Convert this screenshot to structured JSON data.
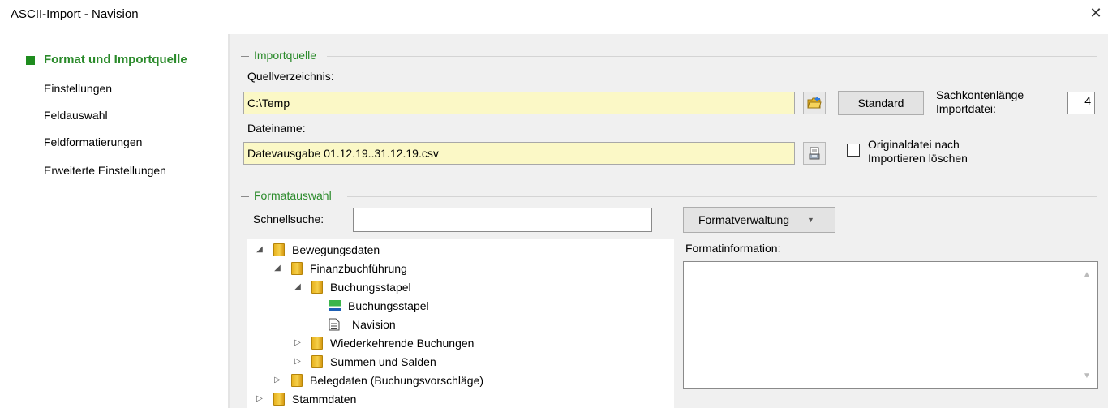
{
  "window": {
    "title": "ASCII-Import - Navision",
    "close_glyph": "✕"
  },
  "sidebar": {
    "items": [
      {
        "label": "Format und Importquelle",
        "active": true
      },
      {
        "label": "Einstellungen",
        "active": false
      },
      {
        "label": "Feldauswahl",
        "active": false
      },
      {
        "label": "Feldformatierungen",
        "active": false
      },
      {
        "label": "Erweiterte Einstellungen",
        "active": false
      }
    ]
  },
  "importquelle": {
    "group_title": "Importquelle",
    "source_dir_label": "Quellverzeichnis:",
    "source_dir_value": "C:\\Temp",
    "standard_button": "Standard",
    "account_length_label_1": "Sachkontenlänge",
    "account_length_label_2": "Importdatei:",
    "account_length_value": "4",
    "filename_label": "Dateiname:",
    "filename_value": "Datevausgabe 01.12.19..31.12.19.csv",
    "delete_checkbox_label_1": "Originaldatei nach",
    "delete_checkbox_label_2": "Importieren löschen",
    "delete_checkbox_checked": false
  },
  "formatauswahl": {
    "group_title": "Formatauswahl",
    "quicksearch_label": "Schnellsuche:",
    "quicksearch_value": "",
    "format_mgmt_button": "Formatverwaltung",
    "format_info_label": "Formatinformation:",
    "format_info_value": "",
    "tree": [
      {
        "label": "Bewegungsdaten",
        "expander": "expanded",
        "icon": "folder-icon"
      },
      {
        "label": "Finanzbuchführung",
        "expander": "expanded",
        "icon": "folder-icon"
      },
      {
        "label": "Buchungsstapel",
        "expander": "expanded",
        "icon": "folder-icon"
      },
      {
        "label": "Buchungsstapel",
        "expander": "none",
        "icon": "format-green-icon"
      },
      {
        "label": "Navision",
        "expander": "none",
        "icon": "document-icon"
      },
      {
        "label": "Wiederkehrende Buchungen",
        "expander": "collapsed",
        "icon": "folder-icon"
      },
      {
        "label": "Summen und Salden",
        "expander": "collapsed",
        "icon": "folder-icon"
      },
      {
        "label": "Belegdaten (Buchungsvorschläge)",
        "expander": "collapsed",
        "icon": "folder-icon"
      },
      {
        "label": "Stammdaten",
        "expander": "collapsed",
        "icon": "folder-icon"
      }
    ]
  },
  "colors": {
    "accent_green": "#2a8a2a",
    "input_yellow": "#fbf8c6",
    "panel_gray": "#f0f0f0"
  }
}
